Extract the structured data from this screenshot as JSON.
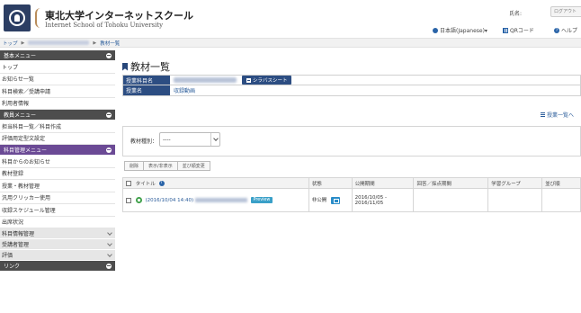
{
  "header": {
    "site_title": "東北大学インターネットスクール",
    "site_subtitle": "Internet School of Tohoku University",
    "user_label": "氏名:",
    "logout_label": "ログアウト",
    "language_menu": "日本語(Japanese)▾",
    "qr_menu": "QRコード",
    "help_menu": "ヘルプ"
  },
  "breadcrumb": {
    "home": "トップ",
    "current": "教材一覧"
  },
  "sidebar": {
    "sections": [
      {
        "title": "基本メニュー",
        "items": [
          "トップ",
          "お知らせ一覧",
          "科目検索／受講申請",
          "利用者情報"
        ]
      },
      {
        "title": "教員メニュー",
        "items": [
          "担当科目一覧／科目作成",
          "評価用定型文設定"
        ]
      },
      {
        "title": "科目管理メニュー",
        "items": [
          "科目からのお知らせ",
          "教材登録",
          "授業・教材管理",
          "汎用クリッカー使用",
          "収録スケジュール管理",
          "出席状況"
        ]
      }
    ],
    "collapsed": [
      "科目情報管理",
      "受講者管理",
      "評価"
    ],
    "footer_section": "リンク"
  },
  "main": {
    "page_title": "教材一覧",
    "info": {
      "course_key": "授業科目名",
      "syllabus_button": "シラバスシート",
      "class_key": "授業名",
      "class_value": "収録動画"
    },
    "course_list_link": "授業一覧へ",
    "filter": {
      "label": "教材種別：",
      "selected": "----"
    },
    "actions": [
      "削除",
      "表示/非表示",
      "並び順変更"
    ],
    "table": {
      "headers": [
        "タイトル",
        "状態",
        "公開期間",
        "回答／採点期間",
        "学習グループ",
        "並び順"
      ],
      "rows": [
        {
          "date": "(2016/10/04 14:40)",
          "badge": "Preview",
          "status": "非公開",
          "period_start": "2016/10/05 -",
          "period_end": "2016/11/05"
        }
      ]
    }
  }
}
